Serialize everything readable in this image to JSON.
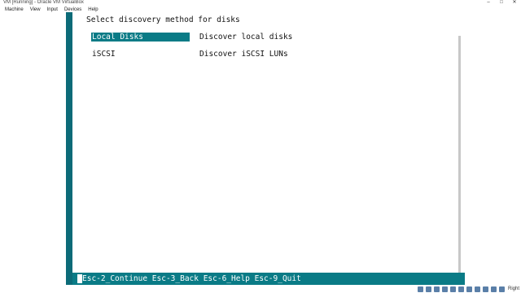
{
  "window": {
    "title": "VM [Running] - Oracle VM VirtualBox",
    "controls": [
      "–",
      "□",
      "✕"
    ]
  },
  "menubar": {
    "items": [
      "Machine",
      "View",
      "Input",
      "Devices",
      "Help"
    ]
  },
  "vm": {
    "heading": "Select discovery method for disks",
    "options": [
      {
        "label": "Local Disks",
        "description": "Discover local disks",
        "selected": true
      },
      {
        "label": "iSCSI",
        "description": "Discover iSCSI LUNs",
        "selected": false
      }
    ],
    "footer": "Esc-2_Continue Esc-3_Back Esc-6_Help Esc-9_Quit"
  },
  "statusbar": {
    "host_key": "Right"
  },
  "colors": {
    "vm_accent": "#0a7b86",
    "vm_border": "#0c6b78"
  }
}
